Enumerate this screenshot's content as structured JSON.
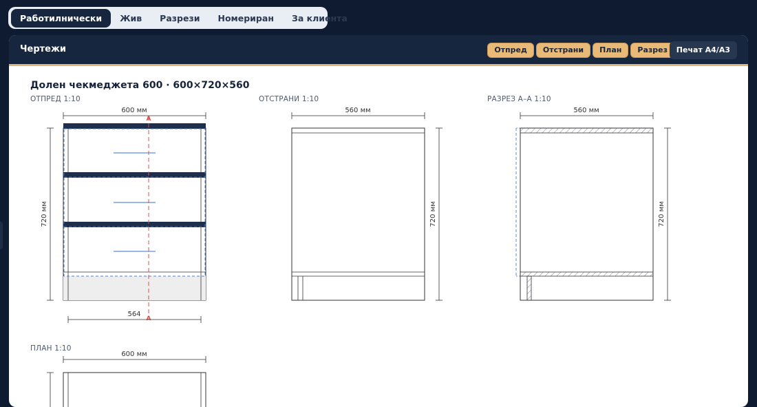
{
  "tabs": [
    {
      "label": "Работилнически",
      "active": true
    },
    {
      "label": "Жив",
      "active": false
    },
    {
      "label": "Разрези",
      "active": false
    },
    {
      "label": "Номериран",
      "active": false
    },
    {
      "label": "За клиента",
      "active": false
    }
  ],
  "panel": {
    "title": "Чертежи",
    "view_buttons": [
      "Отпред",
      "Отстрани",
      "План",
      "Разрез"
    ],
    "print_label": "Печат A4/A3"
  },
  "cabinet": {
    "title": "Долен чекмеджета 600 · 600×720×560"
  },
  "views": {
    "front": {
      "label": "ОТПРЕД 1:10",
      "width_dim": "600 мм",
      "height_dim": "720 мм",
      "inner_dim": "564",
      "section_mark": "A"
    },
    "side": {
      "label": "ОТСТРАНИ 1:10",
      "width_dim": "560 мм",
      "height_dim": "720 мм"
    },
    "section": {
      "label": "РАЗРЕЗ А–А 1:10",
      "width_dim": "560 мм",
      "height_dim": "720 мм"
    },
    "plan": {
      "label": "ПЛАН 1:10",
      "width_dim": "600 мм"
    }
  },
  "colors": {
    "navy": "#16263f",
    "accent": "#e9b978",
    "section_line": "#d9534f",
    "drawer_outline": "#4a7fd0",
    "handle": "#5b8fd6"
  }
}
